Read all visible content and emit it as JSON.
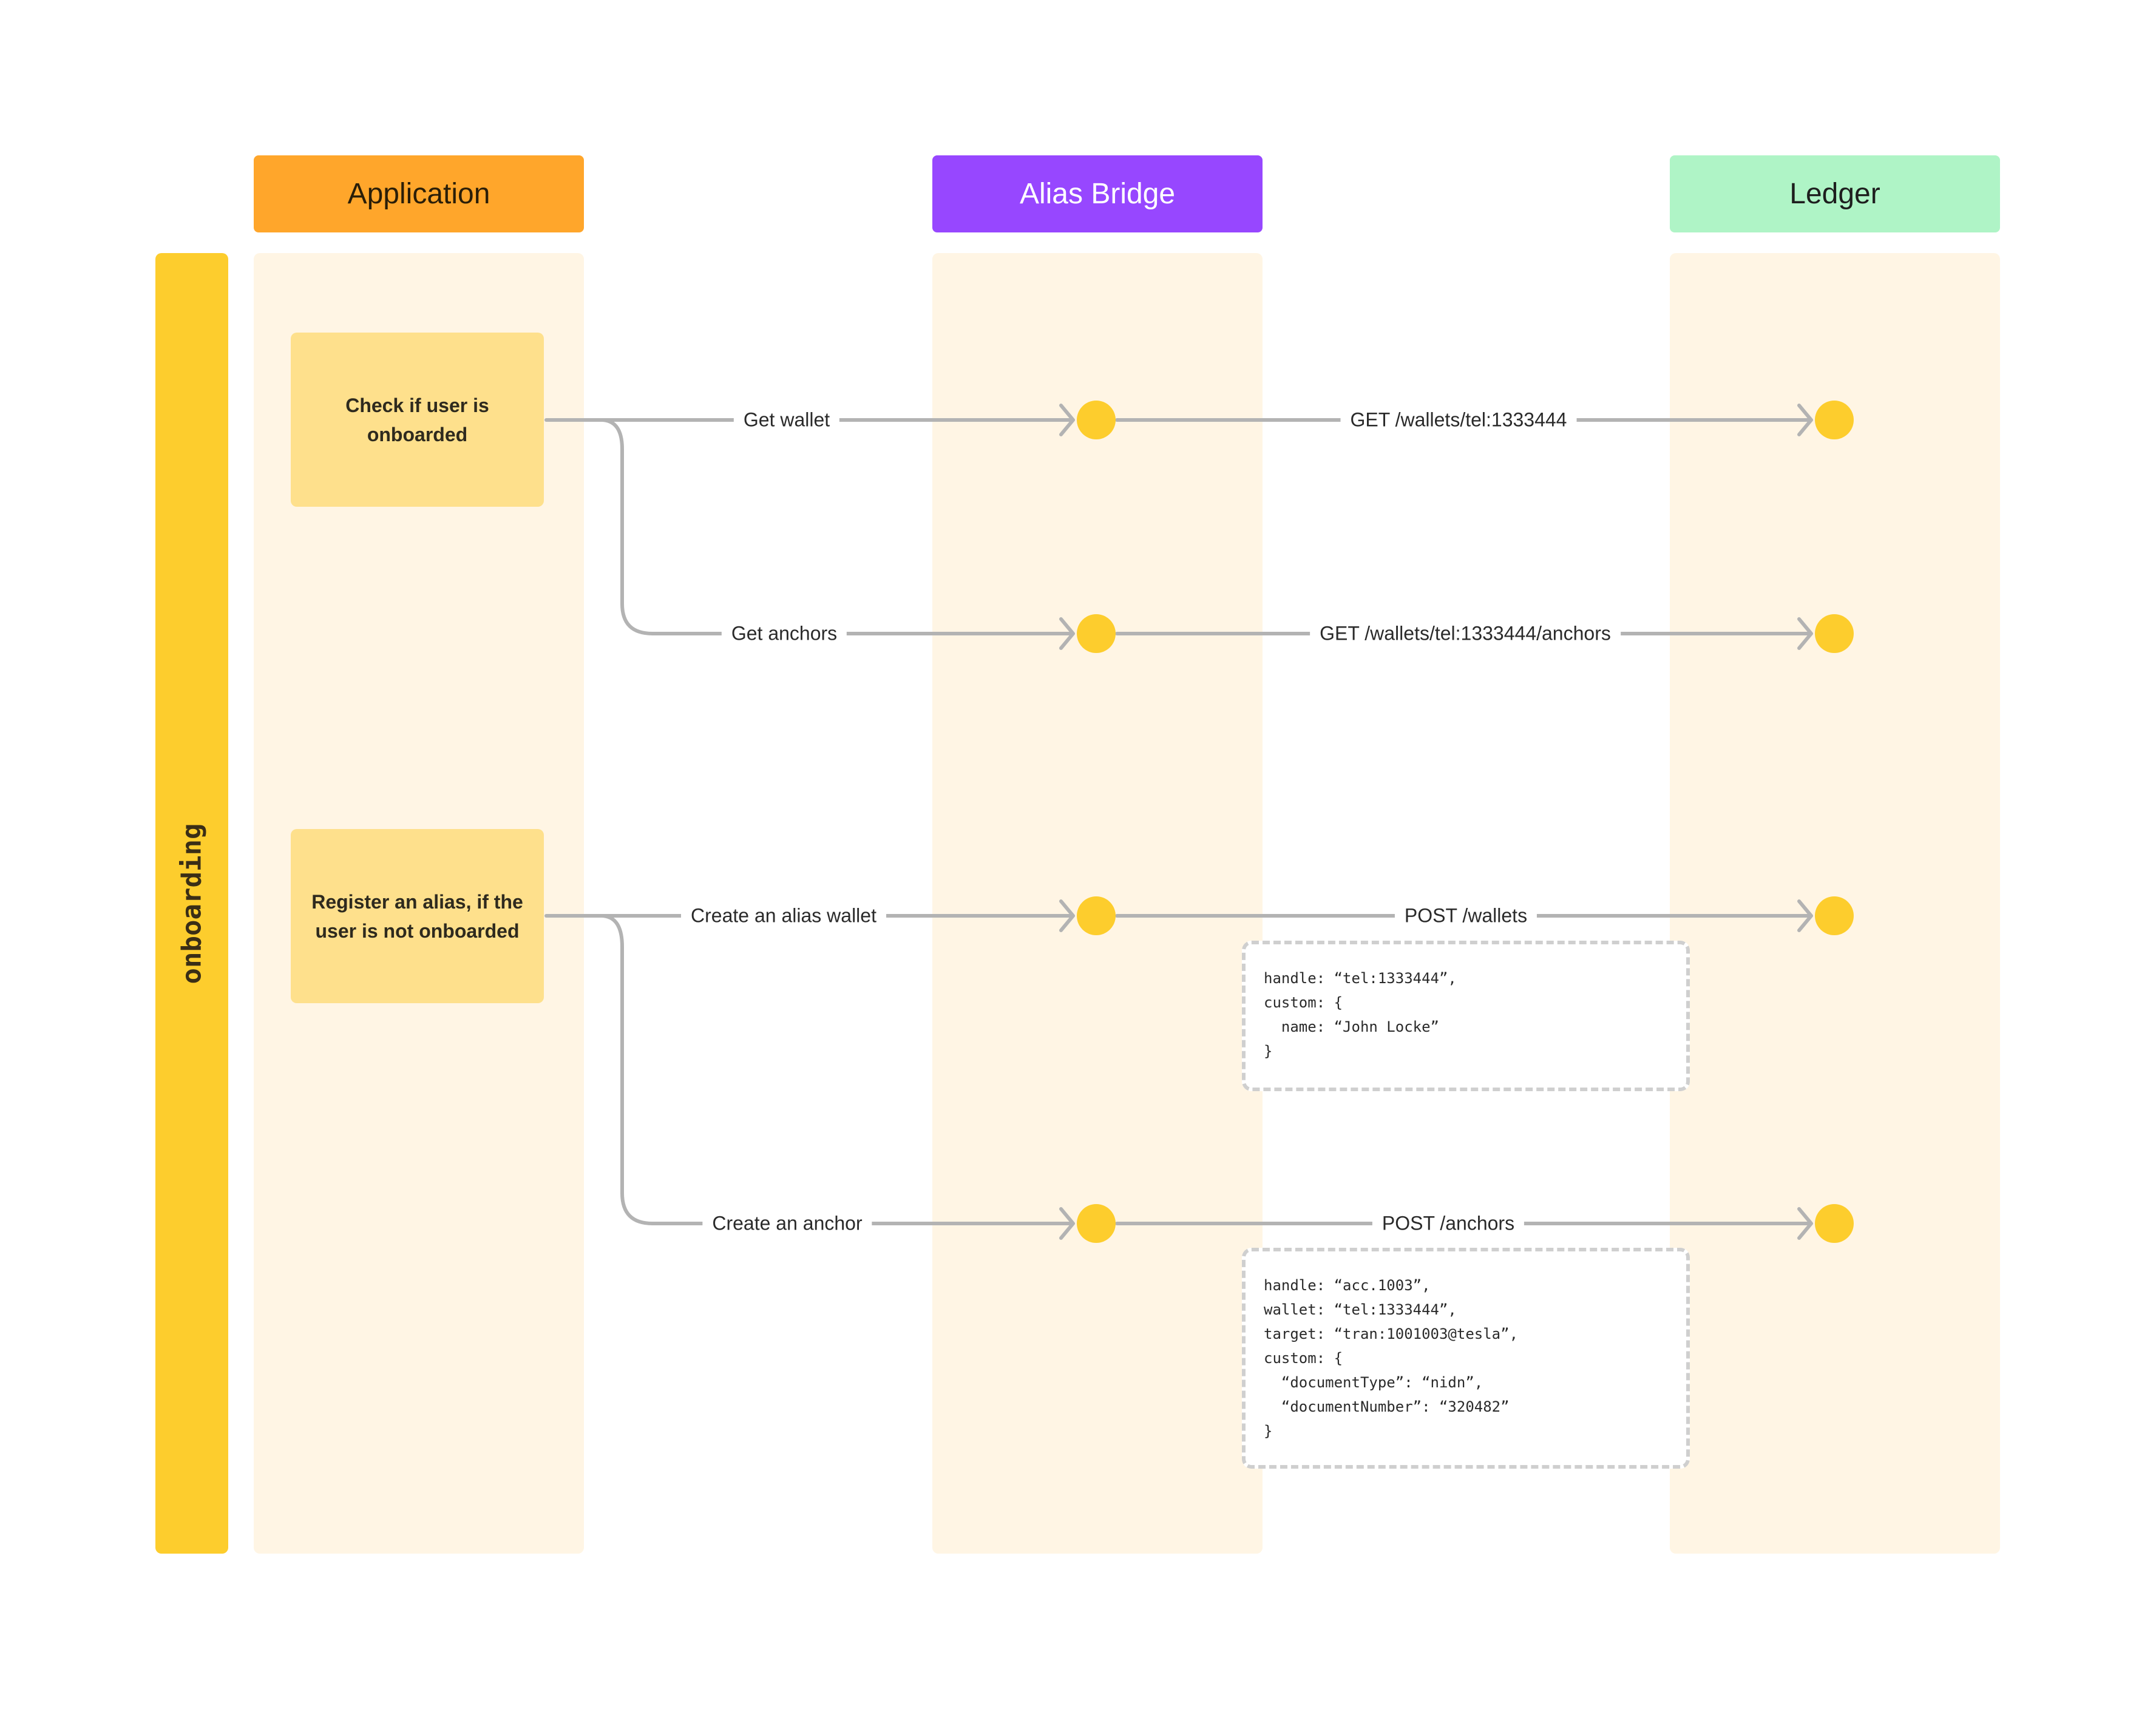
{
  "swimlanes": [
    {
      "id": "application",
      "title": "Application",
      "color": "#ffa62b",
      "text_color": "#2a1e08"
    },
    {
      "id": "alias-bridge",
      "title": "Alias Bridge",
      "color": "#9747ff",
      "text_color": "#ffffff"
    },
    {
      "id": "ledger",
      "title": "Ledger",
      "color": "#aff4c6",
      "text_color": "#1e1e1e"
    }
  ],
  "phase": {
    "label": "onboarding",
    "color": "#fdcd2d"
  },
  "tasks": [
    {
      "text": "Check if user is onboarded"
    },
    {
      "text": "Register an alias, if the user is not onboarded"
    }
  ],
  "flows": [
    {
      "app_call": "Get wallet",
      "ledger_call": "GET /wallets/tel:1333444"
    },
    {
      "app_call": "Get anchors",
      "ledger_call": "GET /wallets/tel:1333444/anchors"
    },
    {
      "app_call": "Create an alias wallet",
      "ledger_call": "POST /wallets"
    },
    {
      "app_call": "Create an anchor",
      "ledger_call": "POST /anchors"
    }
  ],
  "payloads": [
    {
      "for": "POST /wallets",
      "lines": [
        "handle: “tel:1333444”,",
        "custom: {",
        "  name: “John Locke”",
        "}"
      ]
    },
    {
      "for": "POST /anchors",
      "lines": [
        "handle: “acc.1003”,",
        "wallet: “tel:1333444”,",
        "target: “tran:1001003@tesla”,",
        "custom: {",
        "  “documentType”: “nidn”,",
        "  “documentNumber”: “320482”",
        "}"
      ]
    }
  ],
  "colors": {
    "connector": "#b3b3b3",
    "node": "#fdcd2d",
    "lane_bg": "#fff5e4",
    "task_bg": "#fee08c"
  }
}
